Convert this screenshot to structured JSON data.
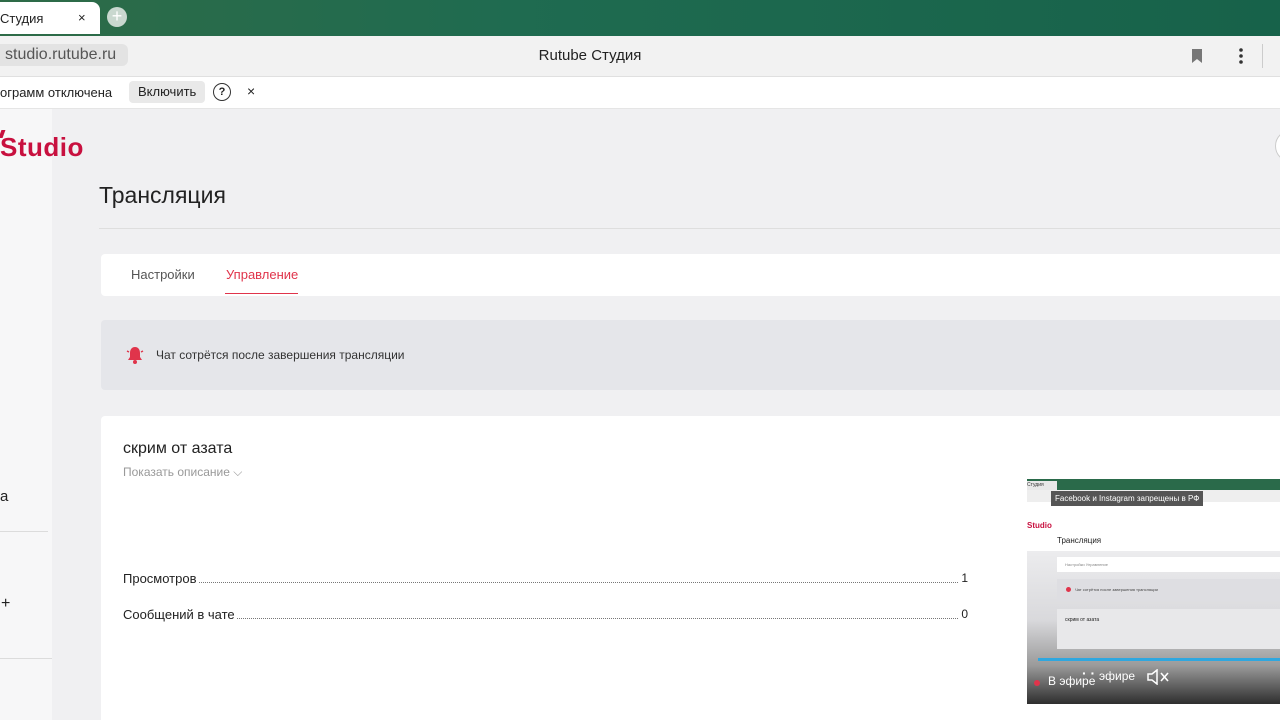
{
  "browser": {
    "tab_title": "Студия",
    "tab_close": "×",
    "new_tab": "+",
    "url": "studio.rutube.ru",
    "page_title": "Rutube Студия"
  },
  "infobar": {
    "text": "ограмм отключена",
    "enable_label": "Включить",
    "help_label": "?",
    "close_label": "×"
  },
  "studio": {
    "logo": "Studio",
    "page_heading": "Трансляция",
    "tabs": [
      {
        "label": "Настройки",
        "active": false
      },
      {
        "label": "Управление",
        "active": true
      }
    ],
    "notice": "Чат сотрётся после завершения трансляции",
    "stream": {
      "title": "скрим от азата",
      "show_description": "Показать описание ⌵",
      "stats": [
        {
          "label": "Просмотров",
          "value": "1"
        },
        {
          "label": "Сообщений в чате",
          "value": "0"
        }
      ]
    }
  },
  "sidebar": {
    "partial_label": "а",
    "plus": "+"
  },
  "preview": {
    "tab_title": "Студия",
    "tooltip": "Facebook и Instagram запрещены в РФ",
    "logo": "Studio",
    "heading": "Трансляция",
    "tabs_text": "Настройки    Управление",
    "notice": "Чат сотрётся после завершения трансляции",
    "stream_title": "скрим от азата",
    "live_label": "В эфире",
    "overlap_text": "эфире",
    "overlap_text2": "· ·",
    "progress": 1.0
  },
  "colors": {
    "accent": "#e0344b",
    "brand": "#c8103f",
    "progress": "#2fa7df"
  }
}
